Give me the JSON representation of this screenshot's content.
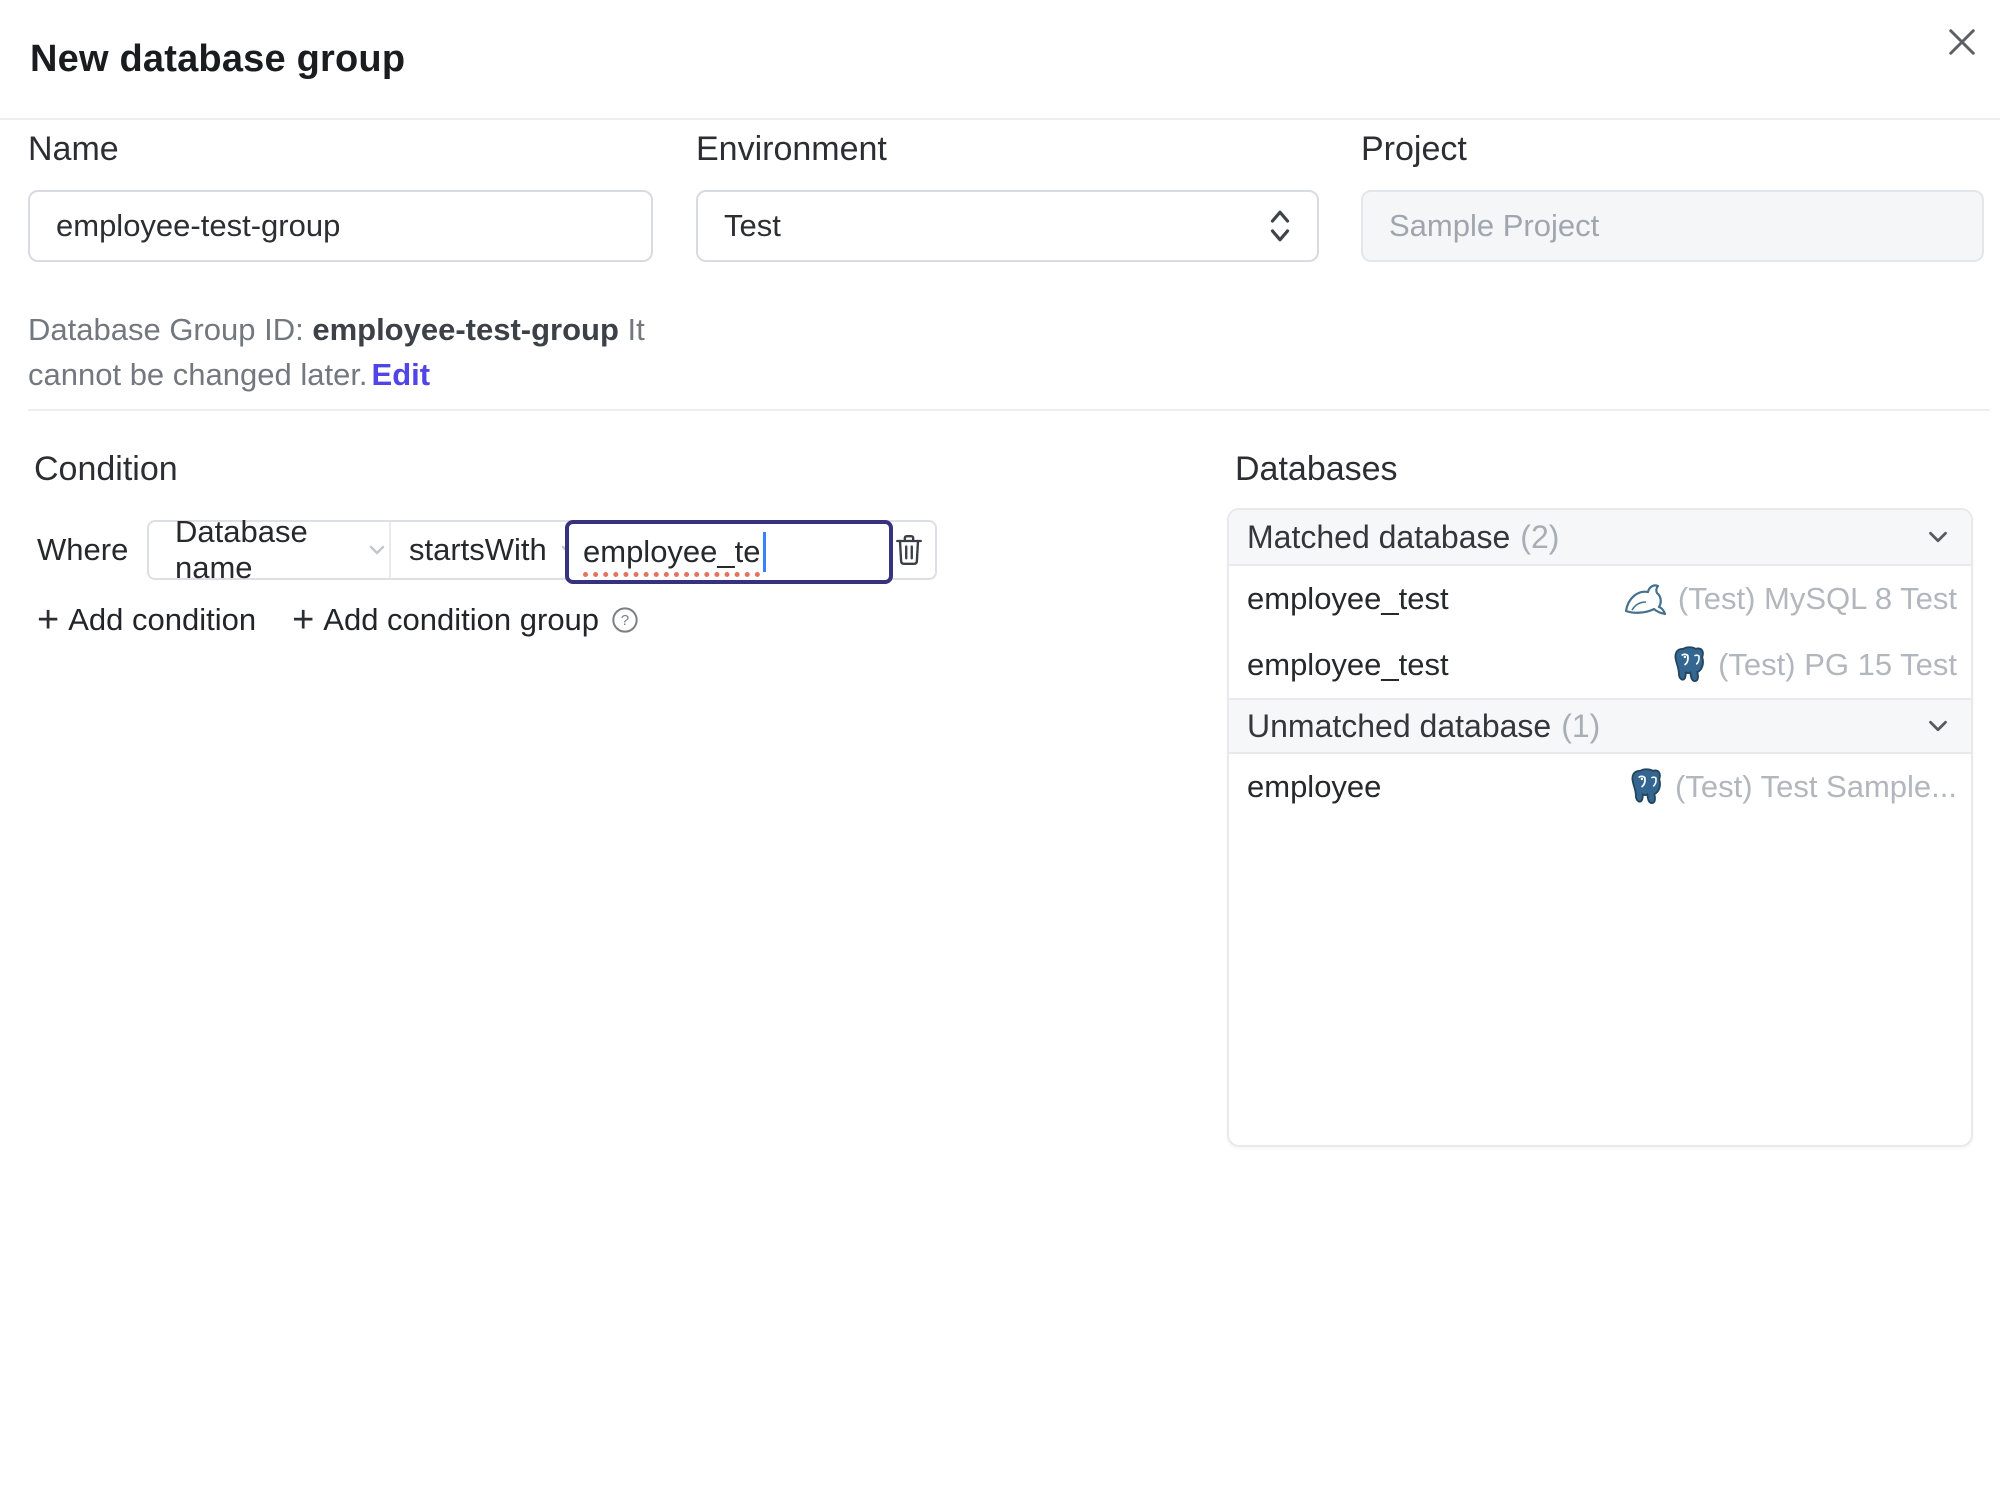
{
  "header": {
    "title": "New database group"
  },
  "form": {
    "name": {
      "label": "Name",
      "value": "employee-test-group"
    },
    "environment": {
      "label": "Environment",
      "value": "Test"
    },
    "project": {
      "label": "Project",
      "value": "Sample Project"
    },
    "helper": {
      "prefix": "Database Group ID: ",
      "group_id": "employee-test-group",
      "suffix": " It cannot be changed later.",
      "edit_label": "Edit"
    }
  },
  "condition": {
    "heading": "Condition",
    "where_label": "Where",
    "field": "Database name",
    "operator": "startsWith",
    "value": "employee_te",
    "add_condition_label": "Add condition",
    "add_condition_group_label": "Add condition group"
  },
  "databases": {
    "heading": "Databases",
    "groups": [
      {
        "title": "Matched database",
        "count": "(2)",
        "rows": [
          {
            "name": "employee_test",
            "engine": "mysql",
            "instance": "(Test) MySQL 8 Test"
          },
          {
            "name": "employee_test",
            "engine": "postgres",
            "instance": "(Test) PG 15 Test"
          }
        ]
      },
      {
        "title": "Unmatched database",
        "count": "(1)",
        "rows": [
          {
            "name": "employee",
            "engine": "postgres",
            "instance": "(Test) Test Sample..."
          }
        ]
      }
    ]
  },
  "colors": {
    "accent": "#4f46e5",
    "focus_border": "#36327e",
    "spellcheck_underline": "#e8705f",
    "mysql_icon": "#44718f",
    "postgres_icon": "#336791"
  }
}
